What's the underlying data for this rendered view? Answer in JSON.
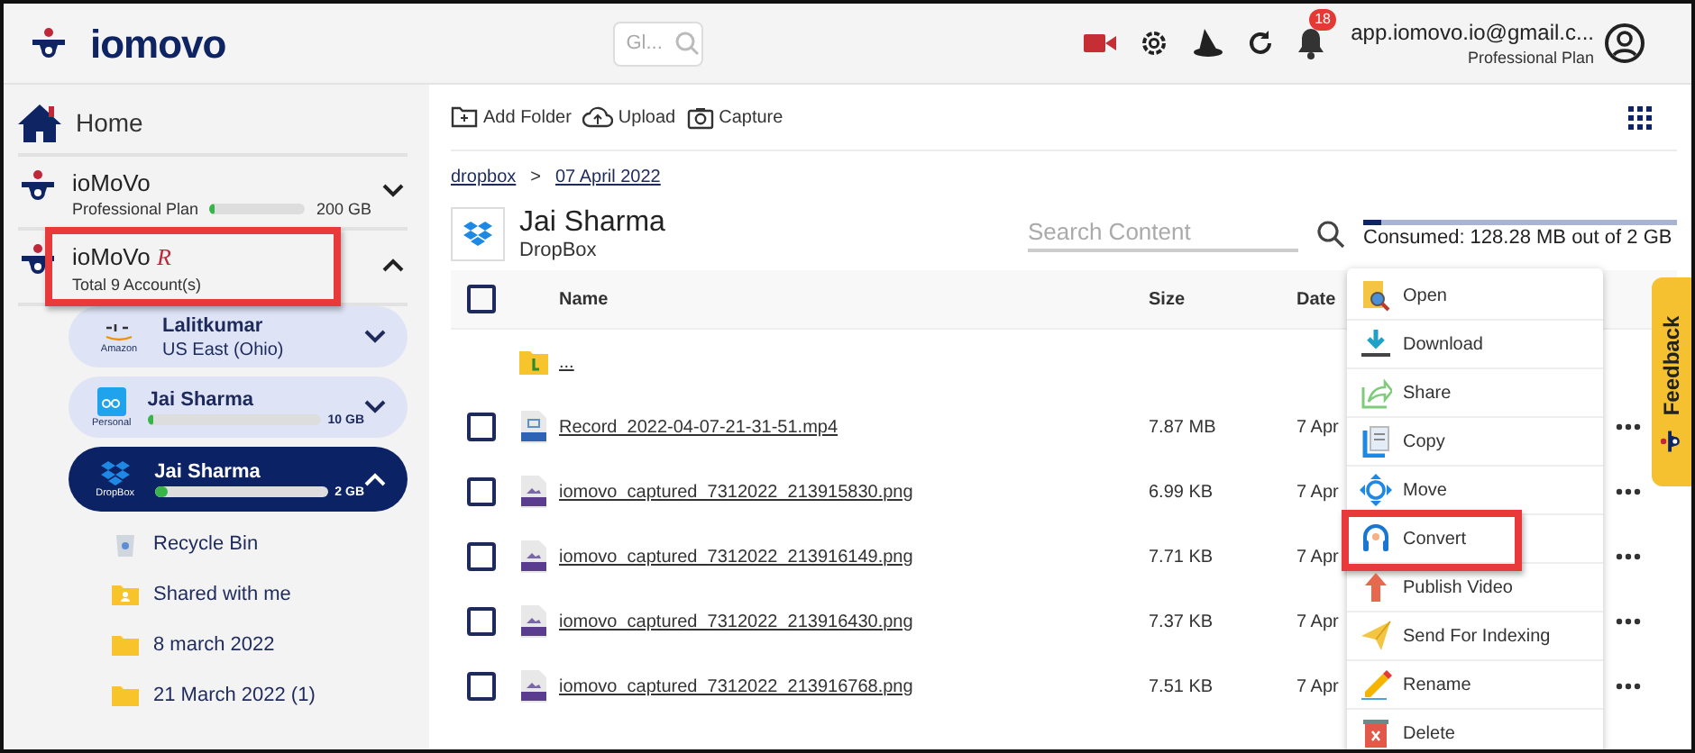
{
  "header": {
    "logo": "iomovo",
    "global_search": {
      "placeholder": "Gl..."
    },
    "notification_count": "18",
    "user": {
      "email": "app.iomovo.io@gmail.c...",
      "plan": "Professional Plan"
    }
  },
  "sidebar": {
    "home": "Home",
    "accounts": [
      {
        "name": "ioMoVo",
        "subtitle": "Professional Plan",
        "level": 0.05,
        "capacity": "200 GB",
        "expanded": false,
        "highlighted": false
      },
      {
        "name": "ioMoVo",
        "suffix": "R",
        "subtitle": "Total 9 Account(s)",
        "expanded": true,
        "highlighted": true
      }
    ],
    "clouds": [
      {
        "kind": "aws",
        "provider": "Amazon",
        "name": "Lalitkumar",
        "subtitle": "US East (Ohio)",
        "selected": false,
        "expanded": false
      },
      {
        "kind": "box",
        "provider": "Personal",
        "name": "Jai Sharma",
        "level": 0.03,
        "capacity": "10 GB",
        "selected": false,
        "expanded": false
      },
      {
        "kind": "dropbox",
        "provider": "DropBox",
        "name": "Jai Sharma",
        "level": 0.08,
        "capacity": "2 GB",
        "selected": true,
        "expanded": true
      }
    ],
    "folders": [
      {
        "kind": "recycle",
        "label": "Recycle Bin"
      },
      {
        "kind": "shared",
        "label": "Shared with me"
      },
      {
        "kind": "folder",
        "label": "8 march 2022"
      },
      {
        "kind": "folder",
        "label": "21 March 2022 (1)"
      }
    ]
  },
  "toolbar": [
    {
      "kind": "folder",
      "label": "Add Folder"
    },
    {
      "kind": "upload",
      "label": "Upload"
    },
    {
      "kind": "capture",
      "label": "Capture"
    }
  ],
  "breadcrumb": [
    "dropbox",
    "07 April 2022"
  ],
  "breadcrumb_separator": ">",
  "location": {
    "title": "Jai Sharma",
    "subtitle": "DropBox"
  },
  "search": {
    "placeholder": "Search Content"
  },
  "storage": {
    "level": 0.06,
    "text": "Consumed: 128.28 MB out of 2 GB"
  },
  "table": {
    "select_all_checked": false,
    "columns": [
      "Name",
      "Size",
      "Date"
    ],
    "rows": [
      {
        "kind": "parent",
        "name": "...",
        "size": "",
        "date": ""
      },
      {
        "kind": "video",
        "name": "Record_2022-04-07-21-31-51.mp4",
        "size": "7.87 MB",
        "date": "7 Apr",
        "checked": false
      },
      {
        "kind": "image",
        "name": "iomovo_captured_7312022_213915830.png",
        "size": "6.99 KB",
        "date": "7 Apr",
        "checked": false
      },
      {
        "kind": "image",
        "name": "iomovo_captured_7312022_213916149.png",
        "size": "7.71 KB",
        "date": "7 Apr",
        "checked": false
      },
      {
        "kind": "image",
        "name": "iomovo_captured_7312022_213916430.png",
        "size": "7.37 KB",
        "date": "7 Apr",
        "checked": false
      },
      {
        "kind": "image",
        "name": "iomovo_captured_7312022_213916768.png",
        "size": "7.51 KB",
        "date": "7 Apr",
        "checked": false
      }
    ]
  },
  "context_menu": [
    {
      "kind": "open",
      "label": "Open",
      "highlighted": false
    },
    {
      "kind": "download",
      "label": "Download",
      "highlighted": false
    },
    {
      "kind": "share",
      "label": "Share",
      "highlighted": false
    },
    {
      "kind": "copy",
      "label": "Copy",
      "highlighted": false
    },
    {
      "kind": "move",
      "label": "Move",
      "highlighted": false
    },
    {
      "kind": "convert",
      "label": "Convert",
      "highlighted": true
    },
    {
      "kind": "publish",
      "label": "Publish Video",
      "highlighted": false
    },
    {
      "kind": "index",
      "label": "Send For Indexing",
      "highlighted": false
    },
    {
      "kind": "rename",
      "label": "Rename",
      "highlighted": false
    },
    {
      "kind": "delete",
      "label": "Delete",
      "highlighted": false
    }
  ],
  "feedback": "Feedback"
}
